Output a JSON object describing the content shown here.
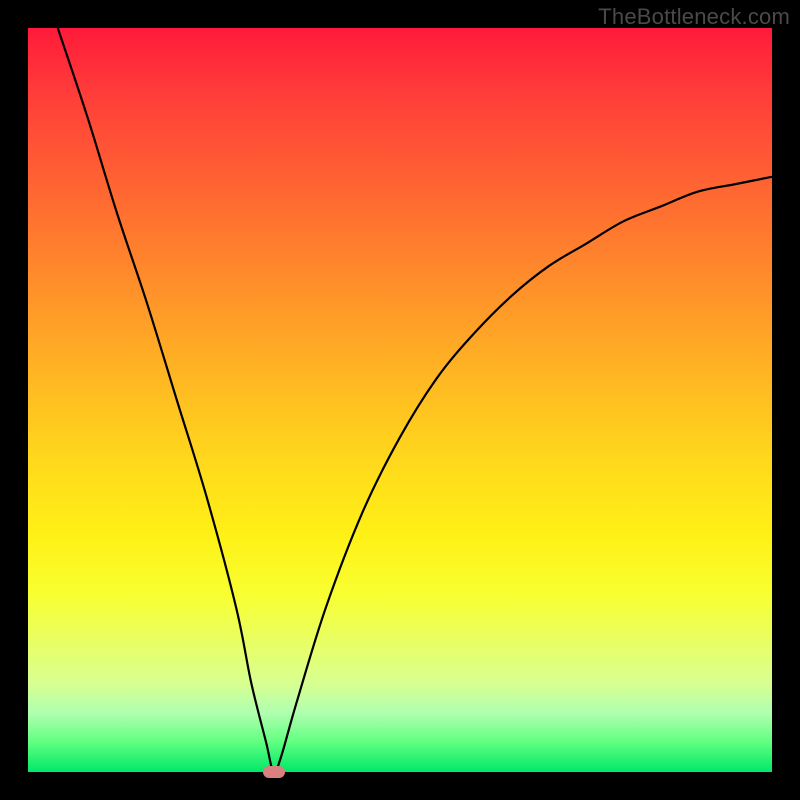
{
  "watermark": "TheBottleneck.com",
  "chart_data": {
    "type": "line",
    "title": "",
    "xlabel": "",
    "ylabel": "",
    "xlim": [
      0,
      100
    ],
    "ylim": [
      0,
      100
    ],
    "background_gradient": {
      "top": "#ff1a3a",
      "middle": "#ffd81c",
      "bottom": "#00e868"
    },
    "series": [
      {
        "name": "bottleneck-curve",
        "color": "#000000",
        "x": [
          4,
          8,
          12,
          16,
          20,
          24,
          28,
          30,
          32,
          33,
          34,
          36,
          40,
          45,
          50,
          55,
          60,
          65,
          70,
          75,
          80,
          85,
          90,
          95,
          100
        ],
        "y": [
          100,
          88,
          75,
          63,
          50,
          37,
          22,
          12,
          4,
          0,
          2,
          9,
          22,
          35,
          45,
          53,
          59,
          64,
          68,
          71,
          74,
          76,
          78,
          79,
          80
        ]
      }
    ],
    "marker": {
      "name": "optimal-point",
      "x": 33,
      "y": 0,
      "color": "#d98080"
    }
  }
}
